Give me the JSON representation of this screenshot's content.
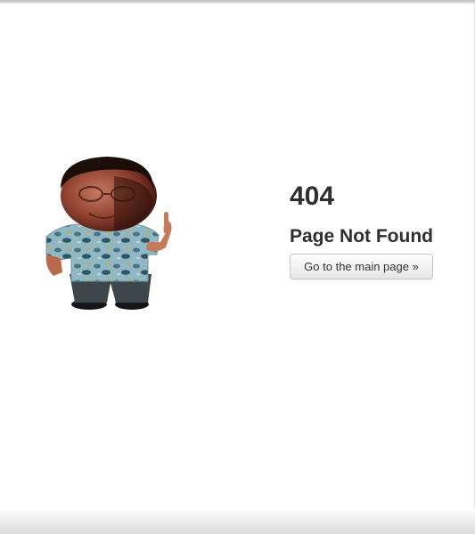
{
  "error": {
    "code": "404",
    "title": "Page Not Found",
    "main_page_button": "Go to the main page »"
  },
  "illustration": {
    "icon": "man-pointing-up-illustration"
  }
}
